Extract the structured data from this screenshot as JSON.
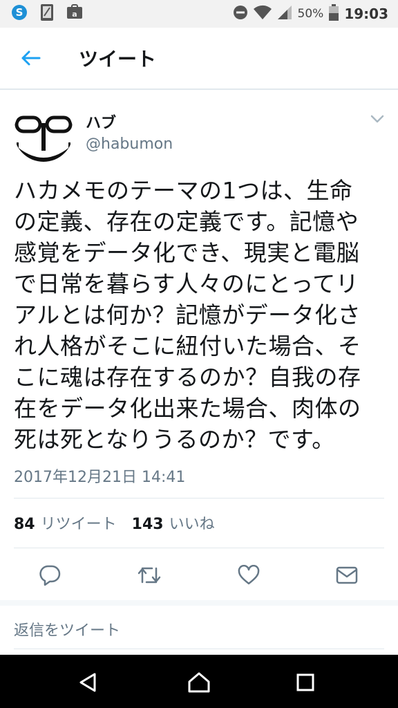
{
  "status_bar": {
    "battery_percent": "50%",
    "time": "19:03"
  },
  "app_bar": {
    "title": "ツイート"
  },
  "tweet": {
    "display_name": "ハブ",
    "handle": "@habumon",
    "lines": [
      "ハカメモのテーマの1つは、生命",
      "の定義、存在の定義です。記憶や",
      "感覚をデータ化でき、現実と電脳",
      "で日常を暮らす人々のにとってリ",
      "アルとは何か？記憶がデータ化さ",
      "れ人格がそこに紐付いた場合、そ",
      "こに魂は存在するのか？自我の存",
      "在をデータ化出来た場合、肉体の",
      "死は死となりうるのか？です。"
    ],
    "timestamp": "2017年12月21日 14:41"
  },
  "stats": {
    "retweet_count": "84",
    "retweet_label": "リツイート",
    "like_count": "143",
    "like_label": "いいね"
  },
  "reply": {
    "placeholder": "返信をツイート"
  },
  "colors": {
    "accent": "#1da1f2",
    "text_primary": "#14171a",
    "text_secondary": "#657786",
    "divider": "#e1e8ed"
  },
  "icons": {
    "status_left": [
      "skype-icon",
      "tablet-icon",
      "amazon-icon"
    ],
    "status_right": [
      "do-not-disturb-icon",
      "wifi-icon",
      "signal-icon",
      "battery-icon"
    ],
    "actions": [
      "reply-icon",
      "retweet-icon",
      "like-icon",
      "message-icon"
    ],
    "nav": [
      "back-triangle-icon",
      "home-icon",
      "recents-icon"
    ]
  }
}
